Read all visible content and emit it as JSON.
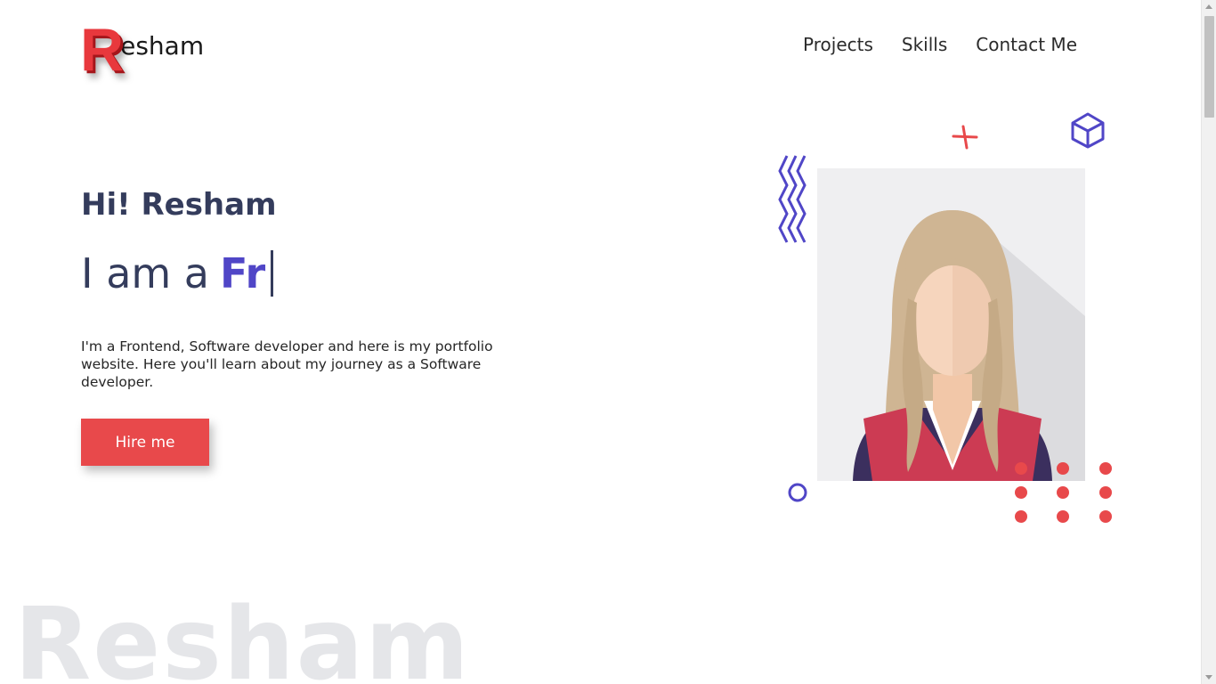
{
  "header": {
    "logo_initial": "R",
    "logo_rest": "esham",
    "nav": [
      "Projects",
      "Skills",
      "Contact Me"
    ]
  },
  "hero": {
    "greeting": "Hi! Resham",
    "typing_prefix": "I am a",
    "typing_text": "Fr",
    "description": "I'm a Frontend, Software developer and here is my portfolio website. Here you'll learn about my journey as a Software developer.",
    "cta_label": "Hire me"
  },
  "watermark": "Resham",
  "colors": {
    "accent_red": "#e8494b",
    "accent_purple": "#5046c7",
    "text_dark": "#343c5c"
  },
  "icons": [
    "zigzag-icon",
    "plus-icon",
    "cube-icon",
    "ring-icon",
    "dot-grid-icon",
    "avatar-illustration"
  ]
}
